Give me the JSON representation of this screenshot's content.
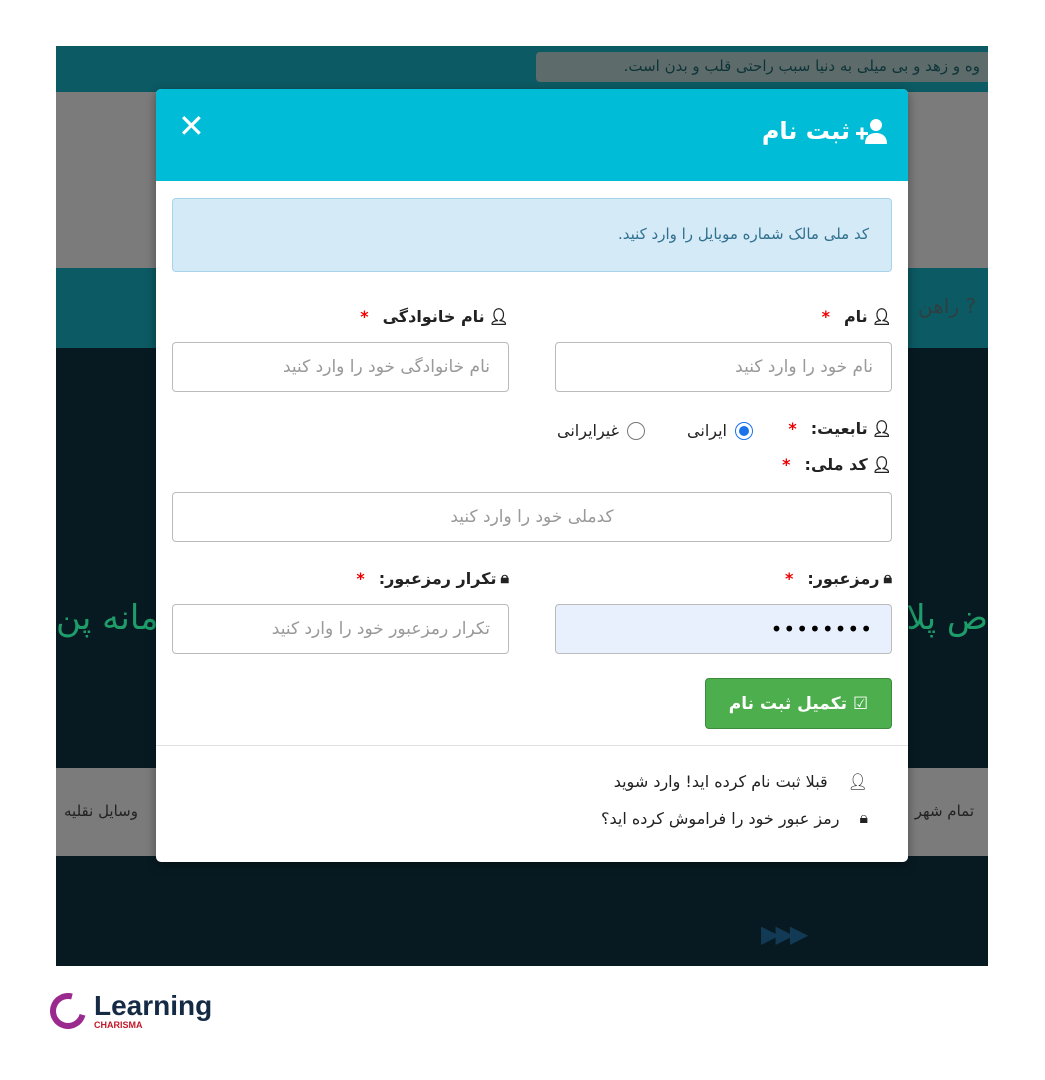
{
  "background": {
    "quote": "وه و زهد و بی میلی به دنیا سبب راحتی قلب و بدن است.",
    "nav_help": "? راهن",
    "side_left": "مانه پن",
    "side_right": "ض پلا",
    "band_left": "وسایل نقلیه",
    "band_right": "تمام شهر"
  },
  "modal": {
    "title": "ثبت نام",
    "title_icon": "user-plus-icon",
    "close": "✕",
    "alert": "کد ملی مالک شماره موبایل را وارد کنید.",
    "first_name": {
      "label": "نام",
      "placeholder": "نام خود را وارد کنید"
    },
    "last_name": {
      "label": "نام خانوادگی",
      "placeholder": "نام خانوادگی خود را وارد کنید"
    },
    "nationality": {
      "label": "تابعیت:",
      "options": [
        "ایرانی",
        "غیرایرانی"
      ],
      "selected": "ایرانی"
    },
    "national_code": {
      "label": "کد ملی:",
      "placeholder": "کدملی خود را وارد کنید"
    },
    "password": {
      "label": "رمزعبور:",
      "value": "••••••••"
    },
    "password_repeat": {
      "label": "تکرار رمزعبور:",
      "placeholder": "تکرار رمزعبور خود را وارد کنید"
    },
    "required_mark": "*",
    "submit": "تکمیل ثبت نام",
    "login_link": "قبلا ثبت نام کرده اید! وارد شوید",
    "forgot_link": "رمز عبور خود را فراموش کرده اید؟"
  },
  "logo": {
    "text": "Learning",
    "sub": "CHARISMA"
  },
  "colors": {
    "header": "#00bcd7",
    "button": "#4cae4c",
    "alert": "#d4eaf6",
    "required": "#ee0000"
  }
}
